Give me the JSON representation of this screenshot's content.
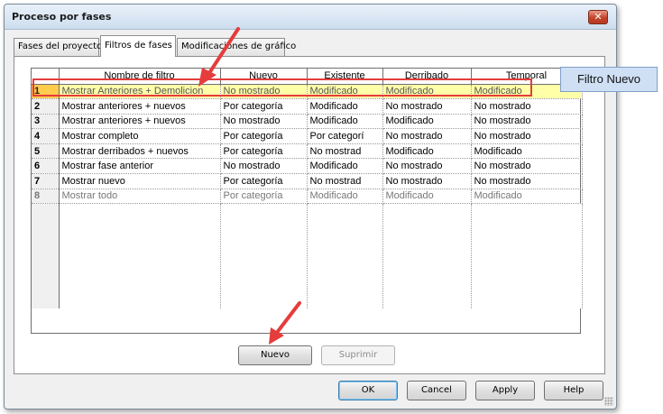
{
  "dialog": {
    "title": "Proceso por fases",
    "close_label": "✕"
  },
  "tabs": [
    {
      "label": "Fases del proyecto",
      "active": false
    },
    {
      "label": "Filtros de fases",
      "active": true
    },
    {
      "label": "Modificaciones de gráfico",
      "active": false
    }
  ],
  "grid": {
    "headers": [
      "",
      "Nombre de filtro",
      "Nuevo",
      "Existente",
      "Derribado",
      "Temporal"
    ],
    "rows": [
      {
        "num": "1",
        "name": "Mostrar Anteriores + Demolicion",
        "nuevo": "No mostrado",
        "existente": "Modificado",
        "derribado": "Modificado",
        "temporal": "Modificado"
      },
      {
        "num": "2",
        "name": "Mostrar anteriores + nuevos",
        "nuevo": "Por categoría",
        "existente": "Modificado",
        "derribado": "No mostrado",
        "temporal": "No mostrado"
      },
      {
        "num": "3",
        "name": "Mostrar anteriores + nuevos",
        "nuevo": "No mostrado",
        "existente": "Modificado",
        "derribado": "Modificado",
        "temporal": "No mostrado"
      },
      {
        "num": "4",
        "name": "Mostrar completo",
        "nuevo": "Por categoría",
        "existente": "Por categorí",
        "derribado": "No mostrado",
        "temporal": "No mostrado"
      },
      {
        "num": "5",
        "name": "Mostrar derribados + nuevos",
        "nuevo": "Por categoría",
        "existente": "No mostrad",
        "derribado": "Modificado",
        "temporal": "Modificado"
      },
      {
        "num": "6",
        "name": "Mostrar fase anterior",
        "nuevo": "No mostrado",
        "existente": "Modificado",
        "derribado": "No mostrado",
        "temporal": "No mostrado"
      },
      {
        "num": "7",
        "name": "Mostrar nuevo",
        "nuevo": "Por categoría",
        "existente": "No mostrad",
        "derribado": "No mostrado",
        "temporal": "No mostrado"
      },
      {
        "num": "8",
        "name": "Mostrar todo",
        "nuevo": "Por categoría",
        "existente": "Modificado",
        "derribado": "Modificado",
        "temporal": "Modificado"
      }
    ]
  },
  "actions": {
    "nuevo": "Nuevo",
    "suprimir": "Suprimir"
  },
  "footer": {
    "ok": "OK",
    "cancel": "Cancel",
    "apply": "Apply",
    "help": "Help"
  },
  "annotation": {
    "callout": "Filtro Nuevo",
    "accent": "#e53c3c"
  }
}
